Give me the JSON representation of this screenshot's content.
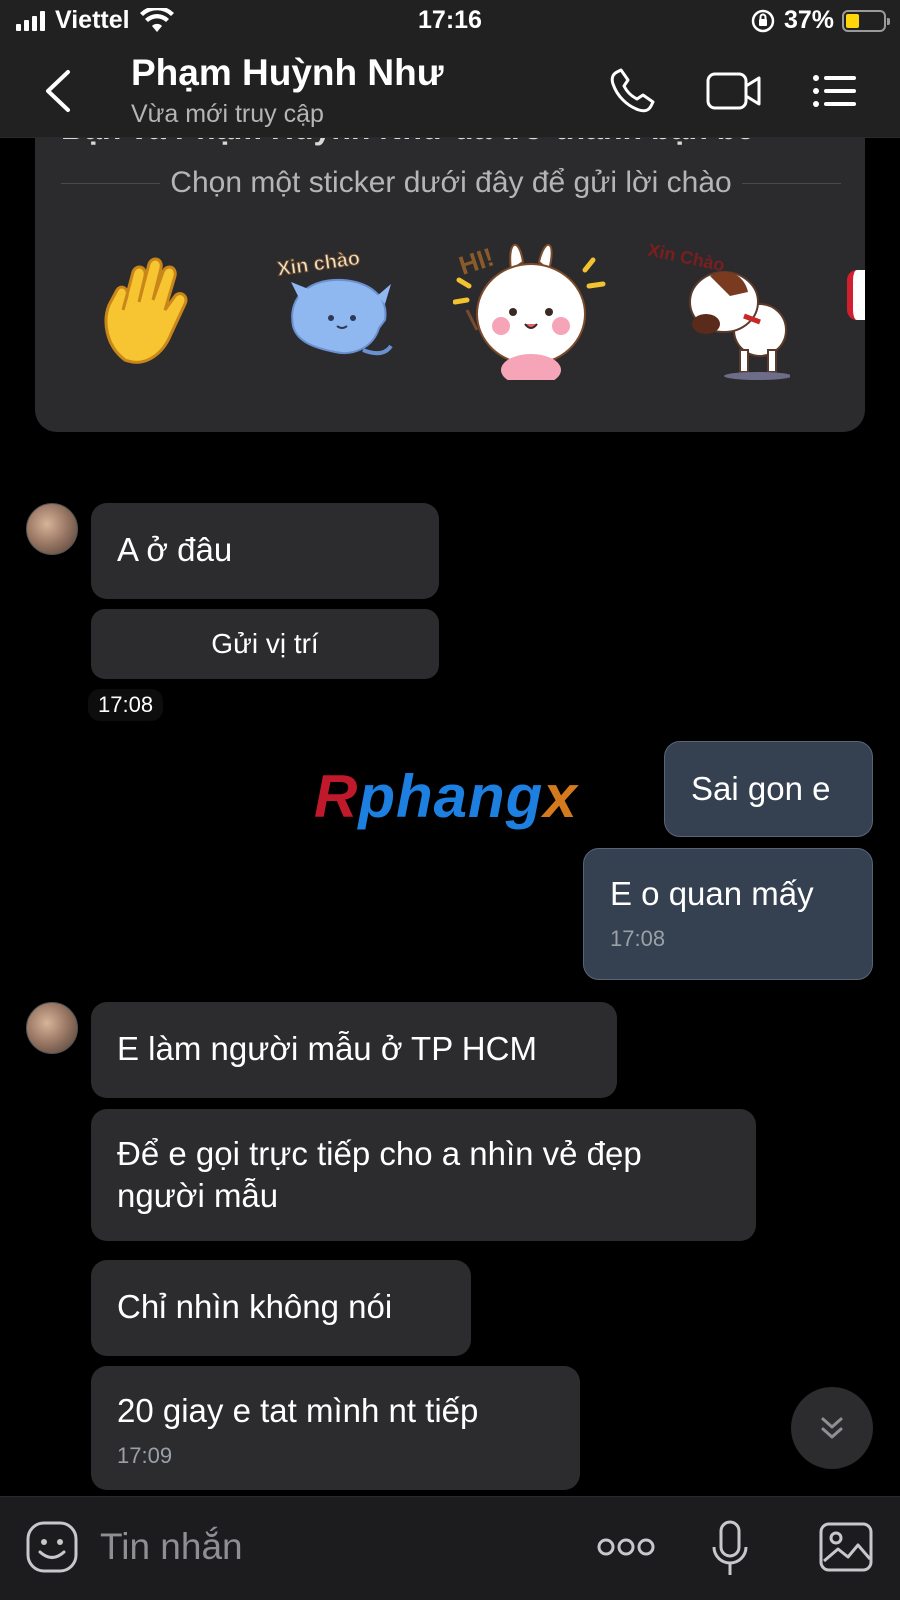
{
  "status_bar": {
    "carrier": "Viettel",
    "time": "17:16",
    "battery": "37%",
    "battery_level": 0.37
  },
  "header": {
    "contact_name": "Phạm Huỳnh Như",
    "contact_status": "Vừa mới truy cập",
    "back_icon": "chevron-left-icon",
    "call_icon": "phone-icon",
    "video_icon": "video-camera-icon",
    "menu_icon": "menu-icon"
  },
  "sticker_card": {
    "title": "Bạn và Phạm Huỳnh Như đã trở thành bạn bè",
    "prompt": "Chọn một sticker dưới đây để gửi lời chào",
    "stickers": [
      {
        "name": "waving-hand-sticker"
      },
      {
        "name": "cat-sticker",
        "caption": "Xin chào"
      },
      {
        "name": "bunny-sticker",
        "caption": "HI!"
      },
      {
        "name": "dog-sticker",
        "caption": "Xin Chào"
      }
    ]
  },
  "messages": [
    {
      "id": "m1",
      "side": "in",
      "text": "A ở đâu"
    },
    {
      "id": "m2",
      "side": "in",
      "type": "location",
      "text": "Gửi vị trí",
      "time": "17:08"
    },
    {
      "id": "m3",
      "side": "out",
      "text": "Sai gon e"
    },
    {
      "id": "m4",
      "side": "out",
      "text": "E o quan mấy",
      "time": "17:08"
    },
    {
      "id": "m5",
      "side": "in",
      "text": "E làm người mẫu ở TP HCM"
    },
    {
      "id": "m6",
      "side": "in",
      "text": "Để e gọi trực tiếp cho a nhìn vẻ đẹp người mẫu"
    },
    {
      "id": "m7",
      "side": "in",
      "text": "Chỉ nhìn không nói"
    },
    {
      "id": "m8",
      "side": "in",
      "text": "20 giay e tat mình nt tiếp",
      "time": "17:09"
    }
  ],
  "watermark": {
    "part1": "R",
    "part2": "phang",
    "part3": "x"
  },
  "input_bar": {
    "placeholder": "Tin nhắn",
    "emoji_icon": "emoji-icon",
    "more_icon": "more-icon",
    "mic_icon": "microphone-icon",
    "image_icon": "image-icon"
  },
  "colors": {
    "background": "#000000",
    "bar": "#212121",
    "incoming_bubble": "#2c2c2e",
    "outgoing_bubble": "#354050",
    "battery": "#ffd60a"
  }
}
